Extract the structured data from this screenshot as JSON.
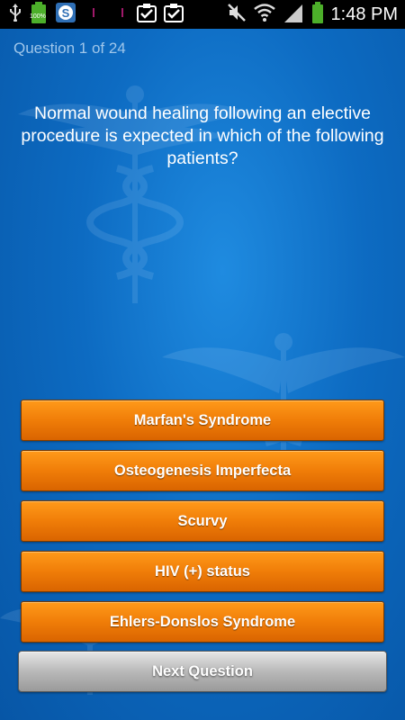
{
  "status_bar": {
    "time": "1:48 PM",
    "battery_small_label": "100%",
    "icons": [
      "usb-icon",
      "battery-full-icon",
      "app-s-icon",
      "notification-dot-icon",
      "notification-dot-icon",
      "task-check-icon",
      "task-check-icon",
      "mute-icon",
      "wifi-icon",
      "signal-icon",
      "battery-icon"
    ]
  },
  "quiz": {
    "counter": "Question 1 of 24",
    "question": "Normal wound healing following an elective procedure is expected in which of the following patients?",
    "answers": [
      "Marfan's Syndrome",
      "Osteogenesis Imperfecta",
      "Scurvy",
      "HIV (+) status",
      "Ehlers-Donslos Syndrome"
    ],
    "next_label": "Next Question"
  },
  "colors": {
    "background": "#0a5fb4",
    "answer_button": "#f07d08",
    "next_button": "#b9b9b9"
  }
}
